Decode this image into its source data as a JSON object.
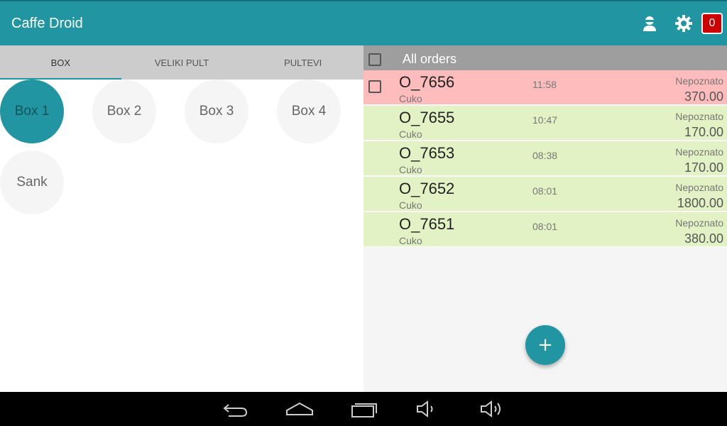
{
  "app": {
    "title": "Caffe Droid",
    "notification_count": "0"
  },
  "icons": {
    "user": "user-icon",
    "settings": "gear-icon",
    "back": "back-icon",
    "home": "home-icon",
    "recents": "recents-icon",
    "volume_down": "volume-down-icon",
    "volume_up": "volume-up-icon",
    "add": "add-icon"
  },
  "colors": {
    "primary": "#2196a2",
    "order_pending": "#ffbcbc",
    "order_done": "#e2f2c4",
    "badge": "#cc0000"
  },
  "tabs": [
    {
      "label": "BOX",
      "active": true
    },
    {
      "label": "VELIKI PULT",
      "active": false
    },
    {
      "label": "PULTEVI",
      "active": false
    }
  ],
  "tables": [
    {
      "label": "Box 1",
      "active": true
    },
    {
      "label": "Box 2",
      "active": false
    },
    {
      "label": "Box 3",
      "active": false
    },
    {
      "label": "Box 4",
      "active": false
    },
    {
      "label": "Sank",
      "active": false
    }
  ],
  "orders_header": {
    "title": "All orders"
  },
  "orders": [
    {
      "id": "O_7656",
      "waiter": "Cuko",
      "time": "11:58",
      "status": "Nepoznato",
      "amount": "370.00",
      "state": "pending"
    },
    {
      "id": "O_7655",
      "waiter": "Cuko",
      "time": "10:47",
      "status": "Nepoznato",
      "amount": "170.00",
      "state": "done"
    },
    {
      "id": "O_7653",
      "waiter": "Cuko",
      "time": "08:38",
      "status": "Nepoznato",
      "amount": "170.00",
      "state": "done"
    },
    {
      "id": "O_7652",
      "waiter": "Cuko",
      "time": "08:01",
      "status": "Nepoznato",
      "amount": "1800.00",
      "state": "done"
    },
    {
      "id": "O_7651",
      "waiter": "Cuko",
      "time": "08:01",
      "status": "Nepoznato",
      "amount": "380.00",
      "state": "done"
    }
  ],
  "fab": {
    "label": "+"
  }
}
